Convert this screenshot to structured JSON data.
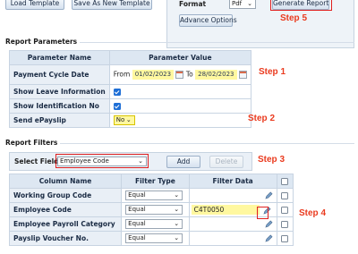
{
  "toolbar": {
    "load_template": "Load Template",
    "save_new_template": "Save As New Template"
  },
  "format_panel": {
    "label": "Format",
    "value": "Pdf",
    "generate": "Generate Report",
    "advance_options": "Advance Options",
    "step_label": "Step 5"
  },
  "params": {
    "section_title": "Report Parameters",
    "col_name": "Parameter Name",
    "col_value": "Parameter Value",
    "rows": {
      "cycle_label": "Payment Cycle Date",
      "from_label": "From",
      "from_date": "01/02/2023",
      "to_label": "To",
      "to_date": "28/02/2023",
      "leave_label": "Show Leave Information",
      "ident_label": "Show Identification No",
      "epay_label": "Send ePayslip",
      "epay_value": "No"
    },
    "step1": "Step 1",
    "step2": "Step 2"
  },
  "filters": {
    "section_title": "Report Filters",
    "select_label": "Select Field",
    "select_value": "Employee Code",
    "add": "Add",
    "delete": "Delete",
    "step3": "Step 3",
    "step4": "Step 4",
    "columns": [
      "Column Name",
      "Filter Type",
      "Filter Data"
    ],
    "rows": [
      {
        "name": "Working Group Code",
        "type": "Equal",
        "data": ""
      },
      {
        "name": "Employee Code",
        "type": "Equal",
        "data": "C4T0050"
      },
      {
        "name": "Employee Payroll Category",
        "type": "Equal",
        "data": ""
      },
      {
        "name": "Payslip Voucher No.",
        "type": "Equal",
        "data": ""
      }
    ]
  },
  "colors": {
    "highlight": "#fff8a0",
    "annotation_red": "#e02020",
    "step_text": "#ea3a1e",
    "checkbox_blue": "#1f6fd6"
  }
}
